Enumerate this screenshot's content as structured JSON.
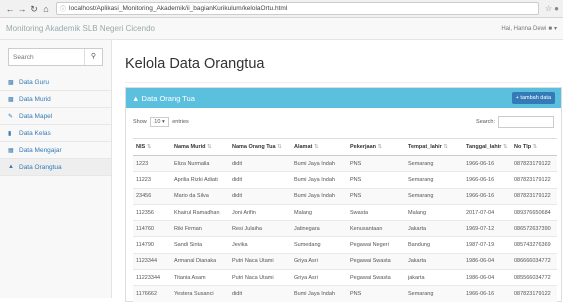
{
  "browser": {
    "url": "localhost/Aplikasi_Monitoring_Akademik/ii_bagianKurikulum/kelolaOrtu.html"
  },
  "topnav": {
    "brand": "Monitoring Akademik SLB Negeri Cicendo",
    "user": "Hai, Hanna Dewi"
  },
  "sidebar": {
    "search_placeholder": "Search",
    "items": [
      {
        "label": "Data Guru",
        "icon": "users-icon"
      },
      {
        "label": "Data Murid",
        "icon": "users-icon"
      },
      {
        "label": "Data Mapel",
        "icon": "edit-icon"
      },
      {
        "label": "Data Kelas",
        "icon": "book-icon"
      },
      {
        "label": "Data Mengajar",
        "icon": "table-icon"
      },
      {
        "label": "Data Orangtua",
        "icon": "user-icon"
      }
    ]
  },
  "main": {
    "title": "Kelola Data Orangtua",
    "panel_title": "Data Orang Tua",
    "add_button": "tambah data",
    "show_label": "Show",
    "show_value": "10",
    "entries_label": "entries",
    "search_label": "Search:",
    "columns": [
      "NIS",
      "Nama Murid",
      "Nama Orang Tua",
      "Alamat",
      "Pekerjaan",
      "Tempat_lahir",
      "Tanggal_lahir",
      "No Tlp"
    ],
    "rows": [
      [
        "1223",
        "Eliza Nurmalia",
        "didit",
        "Bumi Jaya Indah",
        "PNS",
        "Semarang",
        "1966-06-16",
        "087823179122"
      ],
      [
        "11223",
        "Aprilia Rizki Adiati",
        "didit",
        "Bumi Jaya Indah",
        "PNS",
        "Semarang",
        "1966-06-16",
        "087823179122"
      ],
      [
        "23456",
        "Mario da Silva",
        "didit",
        "Bumi Jaya Indah",
        "PNS",
        "Semarang",
        "1966-06-16",
        "087823179122"
      ],
      [
        "112356",
        "Khairul Ramadhan",
        "Joni Arifin",
        "Malang",
        "Swasta",
        "Malang",
        "2017-07-04",
        "089376650684"
      ],
      [
        "114760",
        "Riki Firman",
        "Resi Julaiha",
        "Jatinegara",
        "Kenusantaan",
        "Jakarta",
        "1969-07-12",
        "086572637390"
      ],
      [
        "114790",
        "Sandi Sinta",
        "Jevika",
        "Sumedang",
        "Pegawai Negeri",
        "Bandung",
        "1987-07-19",
        "085743276369"
      ],
      [
        "1123344",
        "Armanal Dianaka",
        "Putri Naca Utami",
        "Griya Asri",
        "Pegawai Swasta",
        "Jakarta",
        "1986-06-04",
        "086666034772"
      ],
      [
        "11223344",
        "Titania Asam",
        "Putri Naca Utami",
        "Griya Asri",
        "Pegawai Swasta",
        "jakarta",
        "1986-06-04",
        "085566034772"
      ],
      [
        "1176662",
        "Yestera Susanci",
        "didit",
        "Bumi Jaya Indah",
        "PNS",
        "Semarang",
        "1966-06-16",
        "087823179122"
      ]
    ]
  },
  "colors": {
    "panel_head": "#5bc0de",
    "add_button": "#337ab7",
    "link": "#337ab7"
  }
}
